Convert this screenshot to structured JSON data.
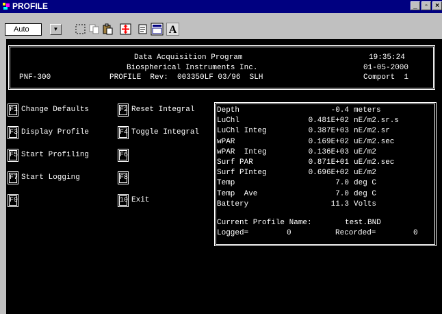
{
  "window": {
    "title": "PROFILE",
    "minimize": "_",
    "maximize": "▫",
    "close": "×"
  },
  "toolbar": {
    "font_value": "Auto",
    "font_letter": "A"
  },
  "header": {
    "line1": "Data Acquisition Program",
    "line2": "Biospherical Instruments Inc.",
    "model": "PNF-300",
    "line3": "PROFILE  Rev:  003350LF 03/96  SLH",
    "time": "19:35:24",
    "date": "01-05-2000",
    "comport": "Comport  1"
  },
  "menu": [
    {
      "key": "F1",
      "label": "Change Defaults"
    },
    {
      "key": "F2",
      "label": "Reset Integral"
    },
    {
      "key": "F3",
      "label": "Display Profile"
    },
    {
      "key": "F4",
      "label": "Toggle Integral"
    },
    {
      "key": "F5",
      "label": "Start Profiling"
    },
    {
      "key": "F6",
      "label": ""
    },
    {
      "key": "F7",
      "label": "Start Logging"
    },
    {
      "key": "F8",
      "label": ""
    },
    {
      "key": "F9",
      "label": ""
    },
    {
      "key": "10",
      "label": "Exit"
    }
  ],
  "readings": [
    {
      "name": "Depth",
      "value": "-0.4",
      "unit": "meters"
    },
    {
      "name": "LuChl",
      "value": "0.481E+02",
      "unit": "nE/m2.sr.s"
    },
    {
      "name": "LuChl Integ",
      "value": "0.387E+03",
      "unit": "nE/m2.sr"
    },
    {
      "name": "wPAR",
      "value": "0.169E+02",
      "unit": "uE/m2.sec"
    },
    {
      "name": "wPAR  Integ",
      "value": "0.136E+03",
      "unit": "uE/m2"
    },
    {
      "name": "Surf PAR",
      "value": "0.871E+01",
      "unit": "uE/m2.sec"
    },
    {
      "name": "Surf PInteg",
      "value": "0.696E+02",
      "unit": "uE/m2"
    },
    {
      "name": "Temp",
      "value": "7.0",
      "unit": "deg C"
    },
    {
      "name": "Temp  Ave",
      "value": "7.0",
      "unit": "deg C"
    },
    {
      "name": "Battery",
      "value": "11.3",
      "unit": "Volts"
    }
  ],
  "status": {
    "profile_label": "Current Profile Name:",
    "profile_name": "test.BND",
    "logged_label": "Logged=",
    "logged_value": "0",
    "recorded_label": "Recorded=",
    "recorded_value": "0"
  }
}
